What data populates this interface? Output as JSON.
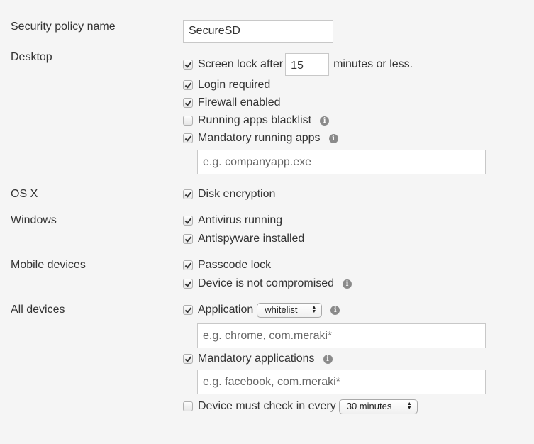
{
  "labels": {
    "policy_name": "Security policy name",
    "desktop": "Desktop",
    "osx": "OS X",
    "windows": "Windows",
    "mobile": "Mobile devices",
    "all": "All devices"
  },
  "policy_name": {
    "value": "SecureSD"
  },
  "desktop": {
    "screen_lock": {
      "checked": true,
      "prefix": "Screen lock after",
      "value": "15",
      "suffix": "minutes or less."
    },
    "login_required": {
      "checked": true,
      "label": "Login required"
    },
    "firewall": {
      "checked": true,
      "label": "Firewall enabled"
    },
    "blacklist": {
      "checked": false,
      "label": "Running apps blacklist"
    },
    "mandatory_apps": {
      "checked": true,
      "label": "Mandatory running apps",
      "placeholder": "e.g. companyapp.exe"
    }
  },
  "osx": {
    "disk_encryption": {
      "checked": true,
      "label": "Disk encryption"
    }
  },
  "windows": {
    "antivirus": {
      "checked": true,
      "label": "Antivirus running"
    },
    "antispyware": {
      "checked": true,
      "label": "Antispyware installed"
    }
  },
  "mobile": {
    "passcode": {
      "checked": true,
      "label": "Passcode lock"
    },
    "not_compromised": {
      "checked": true,
      "label": "Device is not compromised"
    }
  },
  "all": {
    "application": {
      "checked": true,
      "label": "Application",
      "select_value": "whitelist",
      "placeholder": "e.g. chrome, com.meraki*"
    },
    "mandatory_applications": {
      "checked": true,
      "label": "Mandatory applications",
      "placeholder": "e.g. facebook, com.meraki*"
    },
    "check_in": {
      "checked": false,
      "label": "Device must check in every",
      "select_value": "30 minutes"
    }
  },
  "icons": {
    "info": "i"
  }
}
